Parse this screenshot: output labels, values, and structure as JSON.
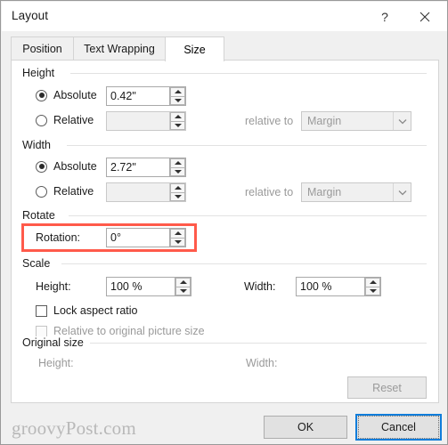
{
  "window": {
    "title": "Layout",
    "help_icon": "question-mark-icon",
    "close_icon": "close-icon"
  },
  "tabs": [
    {
      "label": "Position",
      "active": false
    },
    {
      "label": "Text Wrapping",
      "active": false
    },
    {
      "label": "Size",
      "active": true
    }
  ],
  "height_group": {
    "label": "Height",
    "absolute_label": "Absolute",
    "absolute_value": "0.42\"",
    "absolute_selected": true,
    "relative_label": "Relative",
    "relative_value": "",
    "relative_selected": false,
    "relative_to_label": "relative to",
    "relative_to_value": "Margin"
  },
  "width_group": {
    "label": "Width",
    "absolute_label": "Absolute",
    "absolute_value": "2.72\"",
    "absolute_selected": true,
    "relative_label": "Relative",
    "relative_value": "",
    "relative_selected": false,
    "relative_to_label": "relative to",
    "relative_to_value": "Margin"
  },
  "rotate_group": {
    "label": "Rotate",
    "rotation_label": "Rotation:",
    "rotation_value": "0°",
    "highlight_color": "#ff5a4a"
  },
  "scale_group": {
    "label": "Scale",
    "height_label": "Height:",
    "height_value": "100 %",
    "width_label": "Width:",
    "width_value": "100 %",
    "lock_aspect_label": "Lock aspect ratio",
    "lock_aspect_checked": false,
    "relative_original_label": "Relative to original picture size",
    "relative_original_checked": false
  },
  "original_size_group": {
    "label": "Original size",
    "height_label": "Height:",
    "height_value": "",
    "width_label": "Width:",
    "width_value": "",
    "reset_label": "Reset"
  },
  "footer": {
    "watermark": "groovyPost.com",
    "ok_label": "OK",
    "cancel_label": "Cancel",
    "focus_color": "#0f7ddb"
  }
}
